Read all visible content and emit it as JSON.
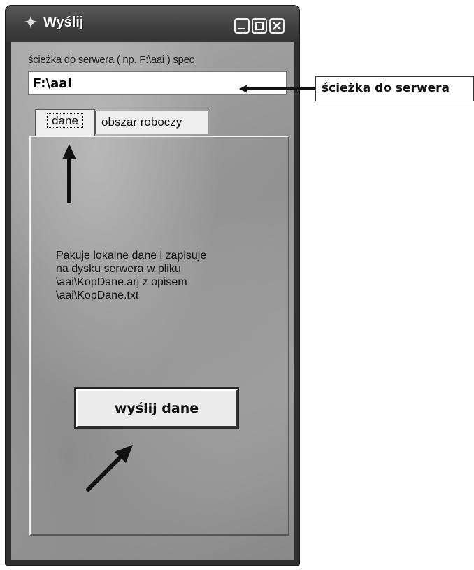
{
  "window": {
    "title": "Wyślij",
    "icons": {
      "app": "app-icon",
      "minimize": "minimize-icon",
      "maximize": "maximize-icon",
      "close": "close-icon"
    }
  },
  "server_path": {
    "label": "ścieżka do serwera ( np. F:\\aai )  spec",
    "value": "F:\\aai"
  },
  "tabs": [
    {
      "label": "dane",
      "active": true
    },
    {
      "label": "obszar roboczy",
      "active": false
    }
  ],
  "description": [
    "Pakuje lokalne dane i zapisuje",
    "na dysku serwera w pliku",
    "\\aai\\KopDane.arj z opisem",
    "\\aai\\KopDane.txt"
  ],
  "send_button": {
    "label": "wyślij dane"
  },
  "callout": {
    "label": "ścieżka do serwera"
  }
}
